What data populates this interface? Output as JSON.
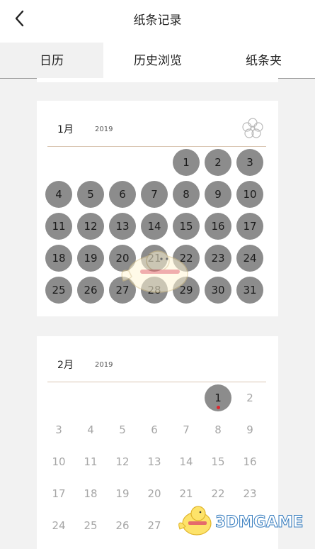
{
  "header": {
    "title": "纸条记录",
    "back_icon": "chevron-left-icon"
  },
  "tabs": [
    {
      "label": "日历",
      "active": true
    },
    {
      "label": "历史浏览",
      "active": false
    },
    {
      "label": "纸条夹",
      "active": false
    }
  ],
  "months": [
    {
      "month": "1月",
      "year": "2019",
      "days": [
        "1",
        "2",
        "3",
        "4",
        "5",
        "6",
        "7",
        "8",
        "9",
        "10",
        "11",
        "12",
        "13",
        "14",
        "15",
        "16",
        "17",
        "18",
        "19",
        "20",
        "21",
        "22",
        "23",
        "24",
        "25",
        "26",
        "27",
        "28",
        "29",
        "30",
        "31"
      ],
      "filled_days": [
        "1",
        "2",
        "3",
        "4",
        "5",
        "6",
        "7",
        "8",
        "9",
        "10",
        "11",
        "12",
        "13",
        "14",
        "15",
        "16",
        "17",
        "18",
        "19",
        "20",
        "21",
        "22",
        "23",
        "24",
        "25",
        "26",
        "27",
        "28",
        "29",
        "30",
        "31"
      ]
    },
    {
      "month": "2月",
      "year": "2019",
      "days": [
        "1",
        "2",
        "3",
        "4",
        "5",
        "6",
        "7",
        "8",
        "9",
        "10",
        "11",
        "12",
        "13",
        "14",
        "15",
        "16",
        "17",
        "18",
        "19",
        "20",
        "21",
        "22",
        "23",
        "24",
        "25",
        "26",
        "27"
      ],
      "filled_days": [
        "1"
      ],
      "marked_days": [
        "1"
      ]
    }
  ],
  "watermark": {
    "text": "3DMGAME"
  },
  "colors": {
    "filled_day": "#8c8c8c",
    "plain_day": "#a6a6a6",
    "marker": "#e0262e",
    "divider": "#d9c6b2"
  }
}
